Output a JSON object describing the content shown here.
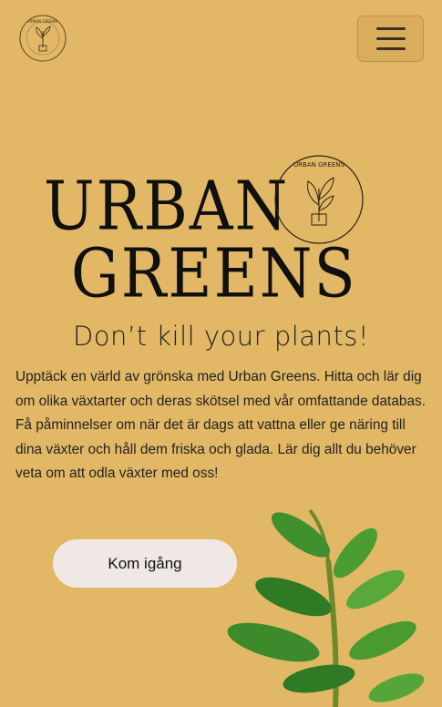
{
  "header": {
    "logo_text": "URBAN GREENS",
    "menu_icon": "hamburger-menu-icon"
  },
  "hero": {
    "title_line1": "URBAN",
    "title_line2": "GREENS",
    "badge_text": "URBAN GREENS",
    "tagline": "Don’t kill your plants!",
    "description": "Upptäck en värld av grönska med Urban Greens. Hitta och lär dig om olika växtarter och deras skötsel med vår omfattande databas. Få påminnelser om när det är dags att vattna eller ge näring till dina växter och håll dem friska och glada. Lär dig allt du behöver veta om att odla växter med oss!",
    "cta_label": "Kom igång"
  },
  "colors": {
    "background": "#e2b866",
    "button_bg": "#f0e8e5",
    "text": "#222222",
    "leaf": "#3f8f2e"
  }
}
